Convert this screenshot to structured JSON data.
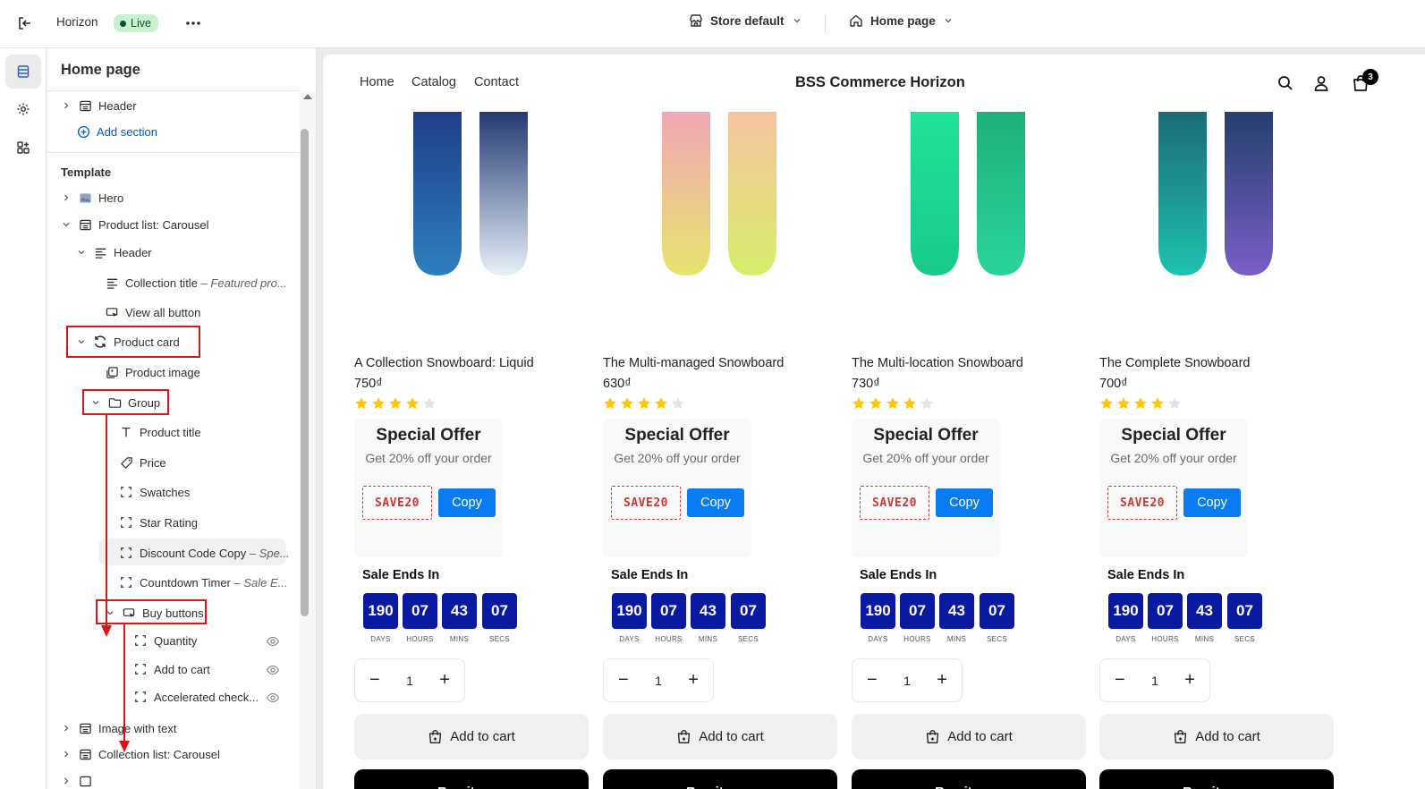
{
  "topbar": {
    "app_name": "Horizon",
    "status_badge": "Live",
    "store_selector": "Store default",
    "page_selector": "Home page"
  },
  "sidebar": {
    "title": "Home page",
    "header_section": "Header",
    "add_section": "Add section",
    "template_label": "Template",
    "items": {
      "hero": "Hero",
      "product_list": "Product list: Carousel",
      "pl_header": "Header",
      "collection_title": "Collection title",
      "collection_title_sub": "– Featured pro...",
      "view_all": "View all button",
      "product_card": "Product card",
      "product_image": "Product image",
      "group": "Group",
      "product_title": "Product title",
      "price": "Price",
      "swatches": "Swatches",
      "star_rating": "Star Rating",
      "discount_code": "Discount Code Copy",
      "discount_code_sub": "– Spe...",
      "countdown": "Countdown Timer",
      "countdown_sub": "– Sale E...",
      "buy_buttons": "Buy buttons",
      "quantity": "Quantity",
      "add_to_cart": "Add to cart",
      "accelerated": "Accelerated check...",
      "image_with_text": "Image with text",
      "collection_list": "Collection list: Carousel"
    }
  },
  "store": {
    "brand": "BSS Commerce Horizon",
    "nav": [
      "Home",
      "Catalog",
      "Contact"
    ],
    "cart_count": "3"
  },
  "products": [
    {
      "title": "A Collection Snowboard: Liquid",
      "price": "750₫",
      "rating": 4
    },
    {
      "title": "The Multi-managed Snowboard",
      "price": "630₫",
      "rating": 4
    },
    {
      "title": "The Multi-location Snowboard",
      "price": "730₫",
      "rating": 4
    },
    {
      "title": "The Complete Snowboard",
      "price": "700₫",
      "rating": 4
    }
  ],
  "offer": {
    "heading": "Special Offer",
    "subheading": "Get 20% off your order",
    "code": "SAVE20",
    "copy_label": "Copy"
  },
  "countdown": {
    "title": "Sale Ends In",
    "days": "190",
    "hours": "07",
    "mins": "43",
    "secs": "07",
    "days_label": "DAYS",
    "hours_label": "HOURS",
    "mins_label": "MINS",
    "secs_label": "SECS"
  },
  "buy": {
    "quantity": "1",
    "minus": "−",
    "plus": "+",
    "add_to_cart": "Add to cart",
    "buy_now": "Buy it now"
  },
  "colors": {
    "accent": "#005bd3",
    "live_bg": "#c8f1d0",
    "countdown_bg": "#0a1aa0",
    "copy_button": "#0a7cf3",
    "code_red": "#c83a3a",
    "annotation_red": "#e01414",
    "star": "#ffc800"
  }
}
